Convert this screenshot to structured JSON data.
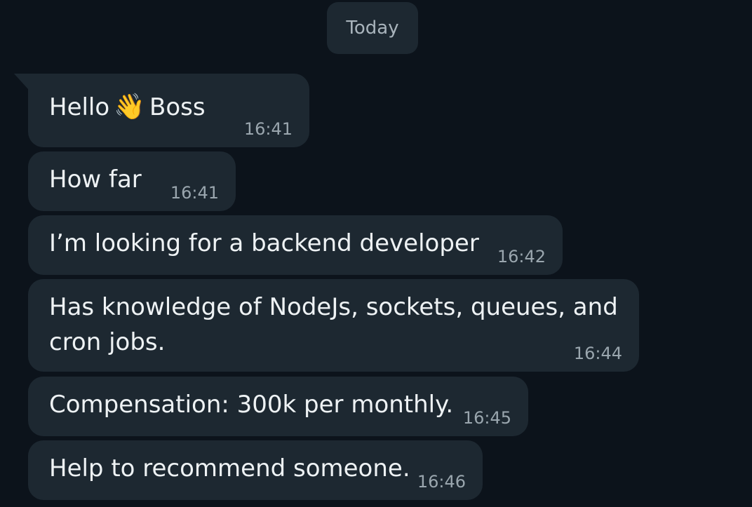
{
  "date_divider": "Today",
  "messages": [
    {
      "part1": "Hello",
      "emoji": "👋",
      "part2": "Boss",
      "time": "16:41"
    },
    {
      "text": "How far",
      "time": "16:41"
    },
    {
      "text": "I’m looking for a backend developer",
      "time": "16:42"
    },
    {
      "line1": "Has knowledge of NodeJs, sockets, queues, and",
      "line2": "cron jobs.",
      "time": "16:44"
    },
    {
      "text": "Compensation: 300k per monthly.",
      "time": "16:45"
    },
    {
      "text": "Help to recommend someone.",
      "time": "16:46"
    }
  ]
}
